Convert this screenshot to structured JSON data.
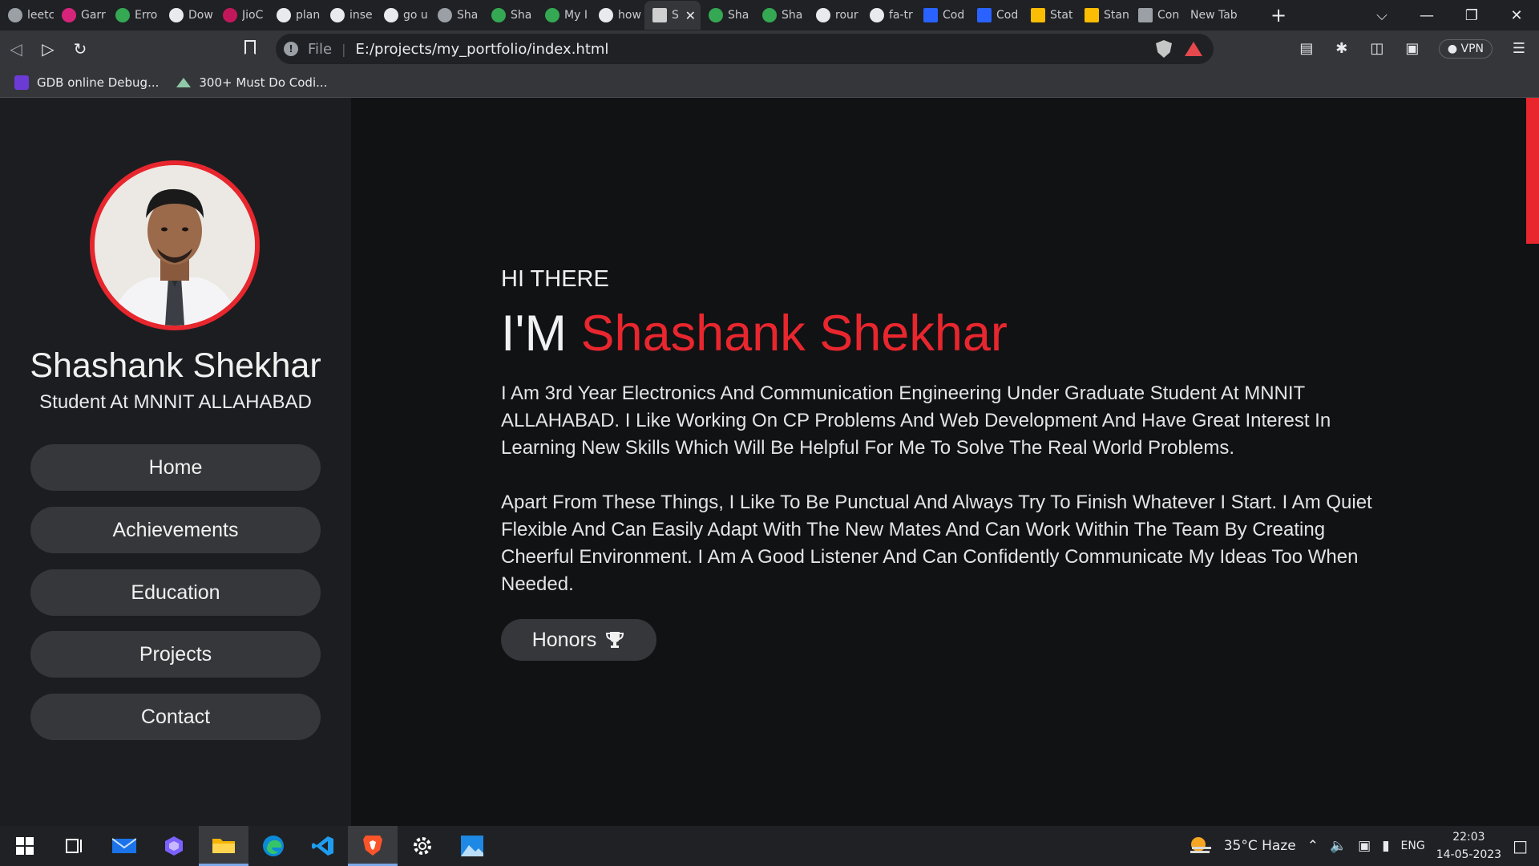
{
  "browser": {
    "tabs": [
      {
        "label": "leetc",
        "icon": "leetcode-icon",
        "color": "#9aa0a6"
      },
      {
        "label": "Garr",
        "icon": "m-logo-icon",
        "color": "#d6247b"
      },
      {
        "label": "Erro",
        "icon": "drive-icon",
        "color": "#34a853"
      },
      {
        "label": "Dow",
        "icon": "download-icon",
        "color": "#e8eaed"
      },
      {
        "label": "JioC",
        "icon": "jio-icon",
        "color": "#c2185b"
      },
      {
        "label": "plan",
        "icon": "google-icon",
        "color": "#e8eaed"
      },
      {
        "label": "inse",
        "icon": "google-icon",
        "color": "#e8eaed"
      },
      {
        "label": "go u",
        "icon": "google-icon",
        "color": "#e8eaed"
      },
      {
        "label": "Sha",
        "icon": "globe-icon",
        "color": "#9aa0a6"
      },
      {
        "label": "Sha",
        "icon": "drive-icon",
        "color": "#34a853"
      },
      {
        "label": "My I",
        "icon": "drive-icon",
        "color": "#34a853"
      },
      {
        "label": "how",
        "icon": "google-icon",
        "color": "#e8eaed"
      }
    ],
    "active_tab": {
      "label": "S",
      "icon": "profile-photo-icon"
    },
    "tabs_after": [
      {
        "label": "Sha",
        "icon": "drive-icon",
        "color": "#34a853"
      },
      {
        "label": "Sha",
        "icon": "drive-icon",
        "color": "#34a853"
      },
      {
        "label": "rour",
        "icon": "google-icon",
        "color": "#e8eaed"
      },
      {
        "label": "fa-tr",
        "icon": "flag-icon",
        "color": "#e8eaed"
      },
      {
        "label": "Cod",
        "icon": "codechef-icon",
        "color": "#2962ff"
      },
      {
        "label": "Cod",
        "icon": "codechef-icon",
        "color": "#2962ff"
      },
      {
        "label": "Stat",
        "icon": "bar-chart-icon",
        "color": "#fbbc04"
      },
      {
        "label": "Stan",
        "icon": "bar-chart-icon",
        "color": "#fbbc04"
      },
      {
        "label": "Con",
        "icon": "cc-icon",
        "color": "#9aa0a6"
      }
    ],
    "new_tab_label": "New Tab",
    "url_protocol": "File",
    "url": "E:/projects/my_portfolio/index.html",
    "vpn_label": "VPN",
    "bookmarks": [
      {
        "label": "GDB online Debug...",
        "icon": "gdb-icon"
      },
      {
        "label": "300+ Must Do Codi...",
        "icon": "geeksforgeeks-icon"
      }
    ]
  },
  "profile": {
    "name": "Shashank Shekhar",
    "role": "Student At MNNIT ALLAHABAD"
  },
  "nav": {
    "items": [
      "Home",
      "Achievements",
      "Education",
      "Projects",
      "Contact"
    ]
  },
  "hero": {
    "greeting": "HI THERE",
    "im": "I'M",
    "highlight_name": "Shashank Shekhar",
    "paragraph1": "I Am 3rd Year Electronics And Communication Engineering Under Graduate Student At MNNIT ALLAHABAD. I Like Working On CP Problems And Web Development And Have Great Interest In Learning New Skills Which Will Be Helpful For Me To Solve The Real World Problems.",
    "paragraph2": "Apart From These Things, I Like To Be Punctual And Always Try To Finish Whatever I Start. I Am Quiet Flexible And Can Easily Adapt With The New Mates And Can Work Within The Team By Creating Cheerful Environment. I Am A Good Listener And Can Confidently Communicate My Ideas Too When Needed.",
    "honors_button": "Honors"
  },
  "colors": {
    "accent": "#e8262e",
    "sidebar_bg": "#1c1d20",
    "page_bg": "#111214",
    "button_bg": "#36373b"
  },
  "taskbar": {
    "apps": [
      "windows-start-icon",
      "task-view-icon",
      "mail-icon",
      "cortana-icon",
      "file-explorer-icon",
      "edge-icon",
      "vscode-icon",
      "brave-icon",
      "settings-icon",
      "photos-icon"
    ],
    "weather": "35°C  Haze",
    "language": "ENG",
    "time": "22:03",
    "date": "14-05-2023"
  }
}
